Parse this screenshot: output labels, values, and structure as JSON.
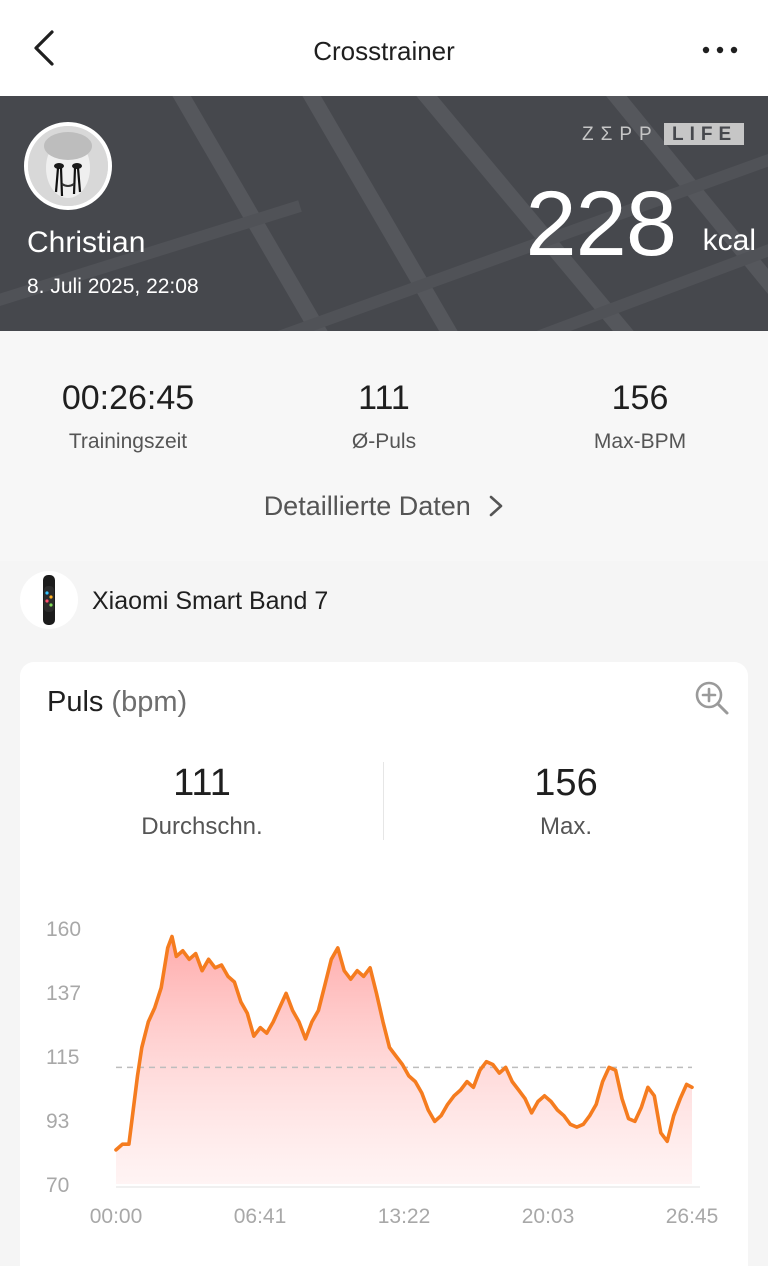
{
  "header": {
    "title": "Crosstrainer"
  },
  "hero": {
    "user_name": "Christian",
    "date": "8. Juli 2025, 22:08",
    "brand": "ZEPP LIFE",
    "brand_left": "ZΣPP",
    "brand_right": "LIFE",
    "calories": "228",
    "calories_unit": "kcal",
    "background_color": "#46484d"
  },
  "summary": {
    "stats": [
      {
        "value": "00:26:45",
        "label": "Trainingszeit"
      },
      {
        "value": "111",
        "label": "Ø-Puls"
      },
      {
        "value": "156",
        "label": "Max-BPM"
      }
    ],
    "details_link": "Detaillierte Daten"
  },
  "device": {
    "name": "Xiaomi Smart Band 7",
    "icon": "smart-band-icon"
  },
  "heart_rate": {
    "title": "Puls",
    "unit": "(bpm)",
    "zoom_icon": "zoom-in-icon",
    "average": {
      "value": "111",
      "label": "Durchschn."
    },
    "max": {
      "value": "156",
      "label": "Max."
    }
  },
  "chart_data": {
    "type": "area",
    "title": "Puls",
    "ylabel": "bpm",
    "y_ticks": [
      "160",
      "137",
      "115",
      "93",
      "70"
    ],
    "x_ticks": [
      "00:00",
      "06:41",
      "13:22",
      "20:03",
      "26:45"
    ],
    "ylim": [
      70,
      160
    ],
    "xlim_minutes": [
      0,
      26.75
    ],
    "average_line": 111,
    "line_color": "#f57c1f",
    "fill_color": "#ff9a9a",
    "points": [
      [
        0.0,
        82
      ],
      [
        0.3,
        84
      ],
      [
        0.6,
        84
      ],
      [
        0.8,
        96
      ],
      [
        1.0,
        108
      ],
      [
        1.2,
        118
      ],
      [
        1.5,
        127
      ],
      [
        1.8,
        132
      ],
      [
        2.1,
        139
      ],
      [
        2.4,
        153
      ],
      [
        2.6,
        157
      ],
      [
        2.8,
        150
      ],
      [
        3.1,
        152
      ],
      [
        3.4,
        149
      ],
      [
        3.7,
        151
      ],
      [
        4.0,
        145
      ],
      [
        4.3,
        149
      ],
      [
        4.6,
        146
      ],
      [
        4.9,
        147
      ],
      [
        5.2,
        143
      ],
      [
        5.5,
        141
      ],
      [
        5.8,
        134
      ],
      [
        6.1,
        130
      ],
      [
        6.4,
        122
      ],
      [
        6.7,
        125
      ],
      [
        7.0,
        123
      ],
      [
        7.3,
        127
      ],
      [
        7.6,
        132
      ],
      [
        7.9,
        137
      ],
      [
        8.2,
        131
      ],
      [
        8.5,
        127
      ],
      [
        8.8,
        121
      ],
      [
        9.1,
        127
      ],
      [
        9.4,
        131
      ],
      [
        9.7,
        140
      ],
      [
        10.0,
        149
      ],
      [
        10.3,
        153
      ],
      [
        10.6,
        145
      ],
      [
        10.9,
        142
      ],
      [
        11.2,
        145
      ],
      [
        11.5,
        143
      ],
      [
        11.8,
        146
      ],
      [
        12.1,
        137
      ],
      [
        12.4,
        127
      ],
      [
        12.7,
        118
      ],
      [
        13.0,
        115
      ],
      [
        13.3,
        112
      ],
      [
        13.6,
        108
      ],
      [
        13.9,
        106
      ],
      [
        14.2,
        102
      ],
      [
        14.5,
        96
      ],
      [
        14.8,
        92
      ],
      [
        15.1,
        94
      ],
      [
        15.4,
        98
      ],
      [
        15.7,
        101
      ],
      [
        16.0,
        103
      ],
      [
        16.3,
        106
      ],
      [
        16.6,
        104
      ],
      [
        16.9,
        110
      ],
      [
        17.2,
        113
      ],
      [
        17.5,
        112
      ],
      [
        17.8,
        109
      ],
      [
        18.1,
        111
      ],
      [
        18.4,
        106
      ],
      [
        18.7,
        103
      ],
      [
        19.0,
        100
      ],
      [
        19.3,
        95
      ],
      [
        19.6,
        99
      ],
      [
        19.9,
        101
      ],
      [
        20.2,
        99
      ],
      [
        20.5,
        96
      ],
      [
        20.8,
        94
      ],
      [
        21.1,
        91
      ],
      [
        21.4,
        90
      ],
      [
        21.7,
        91
      ],
      [
        22.0,
        94
      ],
      [
        22.3,
        98
      ],
      [
        22.6,
        106
      ],
      [
        22.9,
        111
      ],
      [
        23.2,
        110
      ],
      [
        23.5,
        100
      ],
      [
        23.8,
        93
      ],
      [
        24.1,
        92
      ],
      [
        24.4,
        97
      ],
      [
        24.7,
        104
      ],
      [
        25.0,
        101
      ],
      [
        25.3,
        88
      ],
      [
        25.6,
        85
      ],
      [
        25.9,
        94
      ],
      [
        26.2,
        100
      ],
      [
        26.5,
        105
      ],
      [
        26.75,
        104
      ]
    ]
  }
}
